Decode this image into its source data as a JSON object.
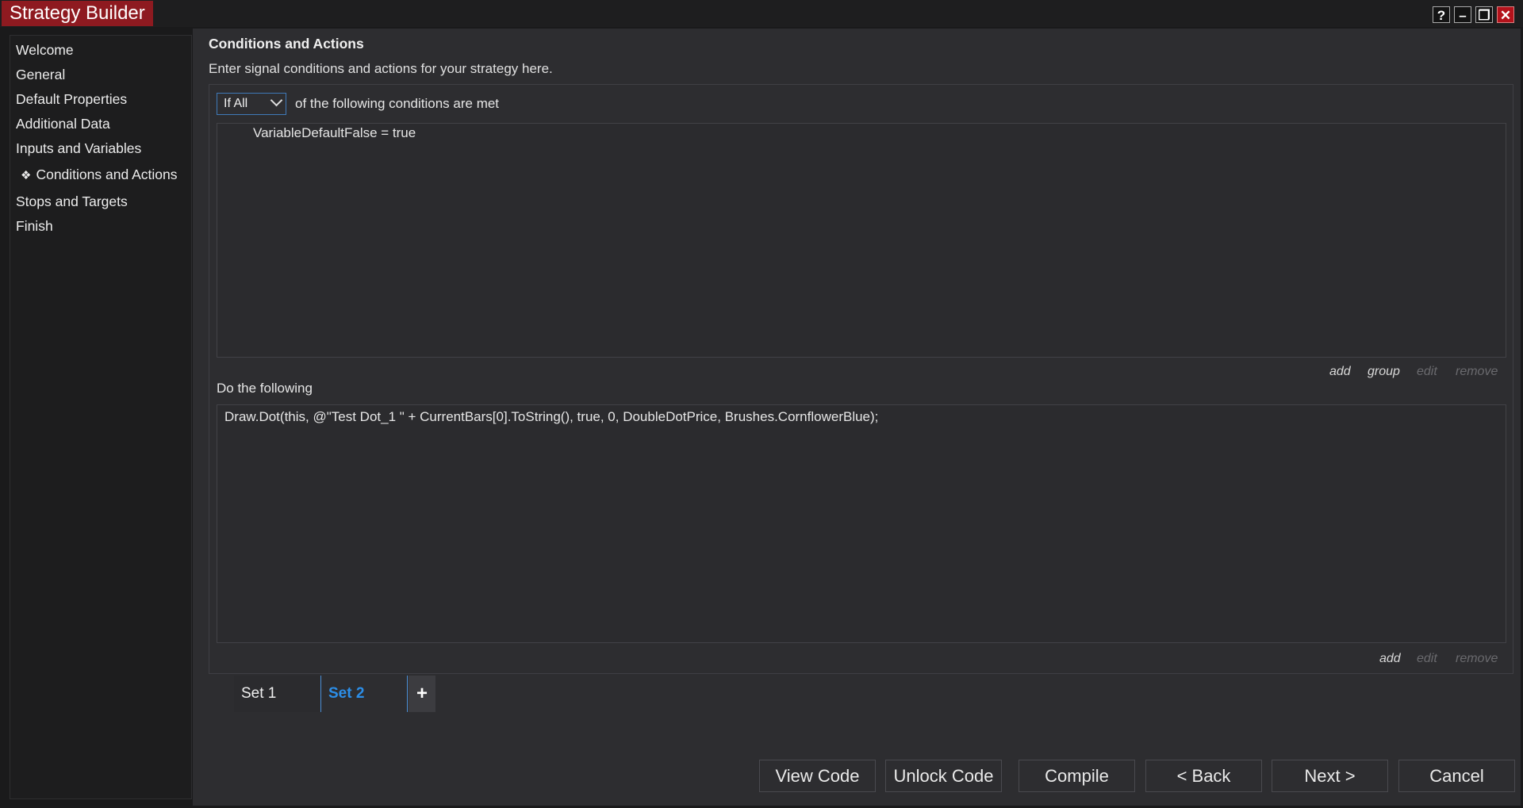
{
  "window": {
    "title": "Strategy Builder",
    "controls": {
      "help": "?",
      "minimize": "–",
      "restore": "❐",
      "close": "✕"
    }
  },
  "sidebar": {
    "items": [
      {
        "label": "Welcome",
        "active": false
      },
      {
        "label": "General",
        "active": false
      },
      {
        "label": "Default Properties",
        "active": false
      },
      {
        "label": "Additional Data",
        "active": false
      },
      {
        "label": "Inputs and Variables",
        "active": false
      },
      {
        "label": "Conditions and Actions",
        "active": true,
        "bullet": "❖"
      },
      {
        "label": "Stops and Targets",
        "active": false
      },
      {
        "label": "Finish",
        "active": false
      }
    ]
  },
  "main": {
    "heading": "Conditions and Actions",
    "subheading": "Enter signal conditions and actions for your strategy here.",
    "condition_mode": "If All",
    "condition_label": "of the following conditions are met",
    "conditions": [
      "VariableDefaultFalse = true"
    ],
    "condition_links": {
      "add": "add",
      "group": "group",
      "edit": "edit",
      "remove": "remove"
    },
    "actions_label": "Do the following",
    "actions": [
      "Draw.Dot(this, @\"Test Dot_1 \" + CurrentBars[0].ToString(), true, 0, DoubleDotPrice, Brushes.CornflowerBlue);"
    ],
    "action_links": {
      "add": "add",
      "edit": "edit",
      "remove": "remove"
    },
    "sets": [
      {
        "label": "Set 1",
        "active": false
      },
      {
        "label": "Set 2",
        "active": true
      }
    ],
    "add_set": "+"
  },
  "footer": {
    "view_code": "View Code",
    "unlock_code": "Unlock Code",
    "compile": "Compile",
    "back": "< Back",
    "next": "Next >",
    "cancel": "Cancel"
  },
  "colors": {
    "title_bg": "#8e1a20",
    "active_tab": "#2c8ee8",
    "select_border": "#3f79b8",
    "close_button": "#b3121b"
  }
}
